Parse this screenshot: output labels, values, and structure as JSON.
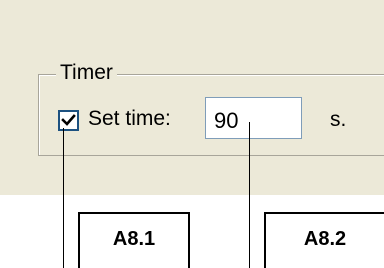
{
  "group": {
    "title": "Timer"
  },
  "set_time": {
    "checked": true,
    "label": "Set time:",
    "value": "90",
    "unit": "s."
  },
  "annotations": {
    "a1": "A8.1",
    "a2": "A8.2"
  },
  "icons": {
    "checkbox": "check-mark-icon"
  },
  "colors": {
    "panel": "#ece9d8",
    "checkbox_border": "#1c5180",
    "input_border": "#7f9db9"
  }
}
